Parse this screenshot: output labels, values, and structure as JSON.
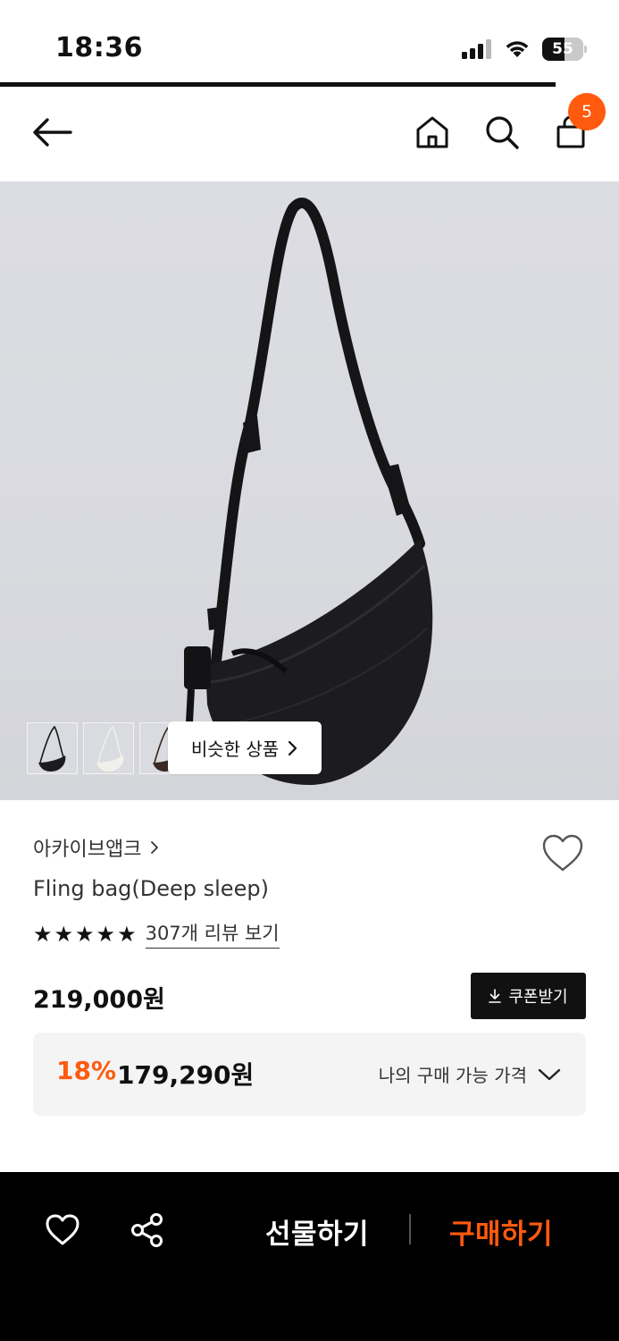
{
  "status_bar": {
    "time": "18:36",
    "battery_level": "55",
    "icons": [
      "signal-icon",
      "wifi-icon",
      "battery-icon"
    ]
  },
  "header": {
    "icons": [
      "back-arrow-icon",
      "home-icon",
      "search-icon",
      "cart-icon"
    ],
    "cart_count": "5"
  },
  "gallery": {
    "thumbnails": [
      "black",
      "white",
      "brown"
    ],
    "similar_label": "비슷한 상품"
  },
  "product": {
    "brand": "아카이브앱크",
    "name": "Fling bag(Deep sleep)",
    "rating_stars": 5,
    "review_link": "307개 리뷰 보기",
    "original_price": "219,000원",
    "coupon_label": "쿠폰받기",
    "discount_rate": "18%",
    "sale_price": "179,290원",
    "my_price_label": "나의 구매 가능 가격"
  },
  "bottom_bar": {
    "gift_label": "선물하기",
    "buy_label": "구매하기"
  },
  "colors": {
    "accent": "#ff5a0e",
    "dark": "#111111",
    "price_box_bg": "#f4f4f5"
  }
}
